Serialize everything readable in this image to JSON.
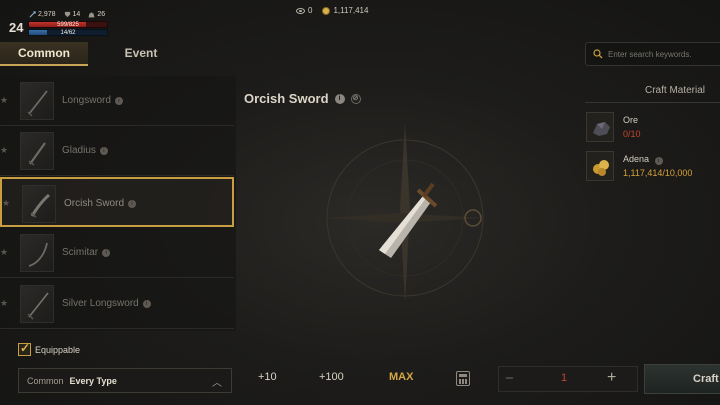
{
  "status": {
    "level": "24",
    "stats": [
      {
        "icon": "attack-icon",
        "value": "2,978"
      },
      {
        "icon": "defense-icon",
        "value": "14"
      },
      {
        "icon": "weight-icon",
        "value": "26"
      }
    ],
    "hp_text": "599/825",
    "hp_fraction": 0.726,
    "mp_text": "14/62",
    "mp_fraction": 0.226
  },
  "currency": {
    "red_diamond": "0",
    "adena": "1,117,414"
  },
  "tabs": [
    {
      "label": "Common",
      "active": true
    },
    {
      "label": "Event",
      "active": false
    }
  ],
  "items": [
    {
      "name": "Longsword",
      "selected": false
    },
    {
      "name": "Gladius",
      "selected": false
    },
    {
      "name": "Orcish Sword",
      "selected": true
    },
    {
      "name": "Scimitar",
      "selected": false
    },
    {
      "name": "Silver Longsword",
      "selected": false
    }
  ],
  "filters": {
    "equippable_label": "Equippable",
    "equippable_checked": true,
    "category": "Common",
    "type": "Every Type"
  },
  "detail": {
    "title": "Orcish Sword"
  },
  "quantity": {
    "plus10": "+10",
    "plus100": "+100",
    "max": "MAX",
    "value": "1",
    "craft_label": "Craft"
  },
  "search": {
    "placeholder": "Enter search keywords."
  },
  "materials": {
    "title": "Craft Material",
    "list": [
      {
        "name": "Ore",
        "count": "0/10",
        "status": "insufficient"
      },
      {
        "name": "Adena",
        "count": "1,117,414/10,000",
        "status": "sufficient"
      }
    ]
  },
  "colors": {
    "accent": "#c89e40",
    "insufficient": "#c0462f",
    "sufficient": "#d6a23a"
  }
}
